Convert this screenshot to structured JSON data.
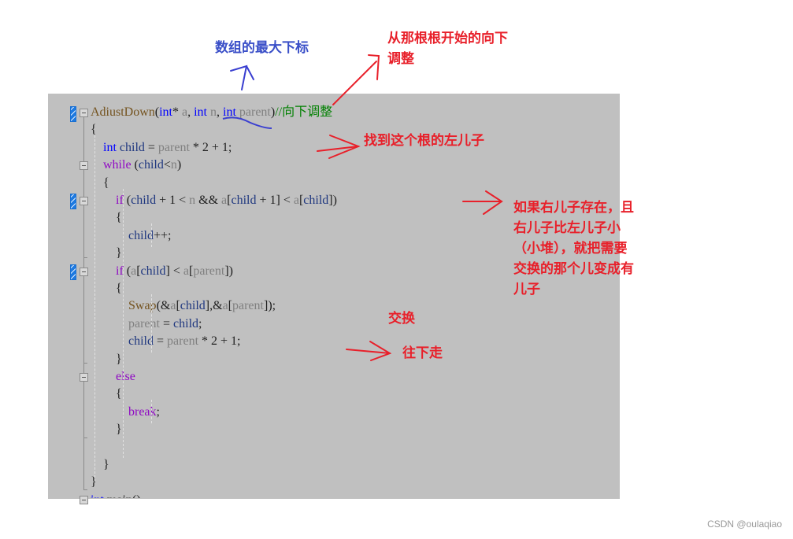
{
  "editor": {
    "lines": [
      {
        "tokens": [
          {
            "t": "AdiustDown",
            "c": "fn"
          },
          {
            "t": "(",
            "c": "op"
          },
          {
            "t": "int",
            "c": "kw"
          },
          {
            "t": "* ",
            "c": "op"
          },
          {
            "t": "a",
            "c": "param"
          },
          {
            "t": ", ",
            "c": "op"
          },
          {
            "t": "int",
            "c": "kw"
          },
          {
            "t": " ",
            "c": "op"
          },
          {
            "t": "n",
            "c": "param"
          },
          {
            "t": ", ",
            "c": "op"
          },
          {
            "t": "int",
            "c": "kw"
          },
          {
            "t": " ",
            "c": "op"
          },
          {
            "t": "parent",
            "c": "param"
          },
          {
            "t": ")",
            "c": "op"
          },
          {
            "t": "//向下调整",
            "c": "cm"
          }
        ]
      },
      {
        "tokens": [
          {
            "t": "{",
            "c": "op"
          }
        ]
      },
      {
        "tokens": [
          {
            "t": "    ",
            "c": "op"
          },
          {
            "t": "int",
            "c": "kw"
          },
          {
            "t": " ",
            "c": "op"
          },
          {
            "t": "child",
            "c": "var"
          },
          {
            "t": " = ",
            "c": "op"
          },
          {
            "t": "parent",
            "c": "param"
          },
          {
            "t": " * 2 + 1;",
            "c": "op"
          }
        ]
      },
      {
        "tokens": [
          {
            "t": "    ",
            "c": "op"
          },
          {
            "t": "while",
            "c": "ctl"
          },
          {
            "t": " (",
            "c": "op"
          },
          {
            "t": "child",
            "c": "var"
          },
          {
            "t": "<",
            "c": "op"
          },
          {
            "t": "n",
            "c": "param"
          },
          {
            "t": ")",
            "c": "op"
          }
        ]
      },
      {
        "tokens": [
          {
            "t": "    {",
            "c": "op"
          }
        ]
      },
      {
        "tokens": [
          {
            "t": "        ",
            "c": "op"
          },
          {
            "t": "if",
            "c": "ctl"
          },
          {
            "t": " (",
            "c": "op"
          },
          {
            "t": "child",
            "c": "var"
          },
          {
            "t": " + 1 < ",
            "c": "op"
          },
          {
            "t": "n",
            "c": "param"
          },
          {
            "t": " && ",
            "c": "op"
          },
          {
            "t": "a",
            "c": "param"
          },
          {
            "t": "[",
            "c": "op"
          },
          {
            "t": "child",
            "c": "var"
          },
          {
            "t": " + 1] < ",
            "c": "op"
          },
          {
            "t": "a",
            "c": "param"
          },
          {
            "t": "[",
            "c": "op"
          },
          {
            "t": "child",
            "c": "var"
          },
          {
            "t": "])",
            "c": "op"
          }
        ]
      },
      {
        "tokens": [
          {
            "t": "        {",
            "c": "op"
          }
        ]
      },
      {
        "tokens": [
          {
            "t": "            ",
            "c": "op"
          },
          {
            "t": "child",
            "c": "var"
          },
          {
            "t": "++;",
            "c": "op"
          }
        ]
      },
      {
        "tokens": [
          {
            "t": "        }",
            "c": "op"
          }
        ]
      },
      {
        "tokens": [
          {
            "t": "        ",
            "c": "op"
          },
          {
            "t": "if",
            "c": "ctl"
          },
          {
            "t": " (",
            "c": "op"
          },
          {
            "t": "a",
            "c": "param"
          },
          {
            "t": "[",
            "c": "op"
          },
          {
            "t": "child",
            "c": "var"
          },
          {
            "t": "] < ",
            "c": "op"
          },
          {
            "t": "a",
            "c": "param"
          },
          {
            "t": "[",
            "c": "op"
          },
          {
            "t": "parent",
            "c": "param"
          },
          {
            "t": "])",
            "c": "op"
          }
        ]
      },
      {
        "tokens": [
          {
            "t": "        {",
            "c": "op"
          }
        ]
      },
      {
        "tokens": [
          {
            "t": "            ",
            "c": "op"
          },
          {
            "t": "Swap",
            "c": "fn"
          },
          {
            "t": "(&",
            "c": "op"
          },
          {
            "t": "a",
            "c": "param"
          },
          {
            "t": "[",
            "c": "op"
          },
          {
            "t": "child",
            "c": "var"
          },
          {
            "t": "],&",
            "c": "op"
          },
          {
            "t": "a",
            "c": "param"
          },
          {
            "t": "[",
            "c": "op"
          },
          {
            "t": "parent",
            "c": "param"
          },
          {
            "t": "]);",
            "c": "op"
          }
        ]
      },
      {
        "tokens": [
          {
            "t": "            ",
            "c": "op"
          },
          {
            "t": "parent",
            "c": "param"
          },
          {
            "t": " = ",
            "c": "op"
          },
          {
            "t": "child",
            "c": "var"
          },
          {
            "t": ";",
            "c": "op"
          }
        ]
      },
      {
        "tokens": [
          {
            "t": "            ",
            "c": "op"
          },
          {
            "t": "child",
            "c": "var"
          },
          {
            "t": " = ",
            "c": "op"
          },
          {
            "t": "parent",
            "c": "param"
          },
          {
            "t": " * 2 + 1;",
            "c": "op"
          }
        ]
      },
      {
        "tokens": [
          {
            "t": "        }",
            "c": "op"
          }
        ]
      },
      {
        "tokens": [
          {
            "t": "        ",
            "c": "op"
          },
          {
            "t": "else",
            "c": "ctl"
          }
        ]
      },
      {
        "tokens": [
          {
            "t": "        {",
            "c": "op"
          }
        ]
      },
      {
        "tokens": [
          {
            "t": "            ",
            "c": "op"
          },
          {
            "t": "break",
            "c": "ctl"
          },
          {
            "t": ";",
            "c": "op"
          }
        ]
      },
      {
        "tokens": [
          {
            "t": "        }",
            "c": "op"
          }
        ]
      },
      {
        "tokens": []
      },
      {
        "tokens": [
          {
            "t": "    }",
            "c": "op"
          }
        ]
      },
      {
        "tokens": [
          {
            "t": "}",
            "c": "op"
          }
        ]
      },
      {
        "tokens": [
          {
            "t": "int",
            "c": "kw"
          },
          {
            "t": " main()",
            "c": "op"
          }
        ]
      }
    ]
  },
  "annotations": {
    "max_index": "数组的最大下标",
    "adjust_from_root": "从那根根开始的向下\n调整",
    "find_left_child": "找到这个根的左儿子",
    "right_child_note": "如果右儿子存在，且\n右儿子比左儿子小\n（小堆），就把需要\n交换的那个儿变成有\n儿子",
    "swap": "交换",
    "go_down": "往下走"
  },
  "colors": {
    "annotation_red": "#e8202a",
    "annotation_blue": "#3a4fc8",
    "editor_background": "#c0c0c0"
  },
  "watermark": "CSDN @oulaqiao"
}
